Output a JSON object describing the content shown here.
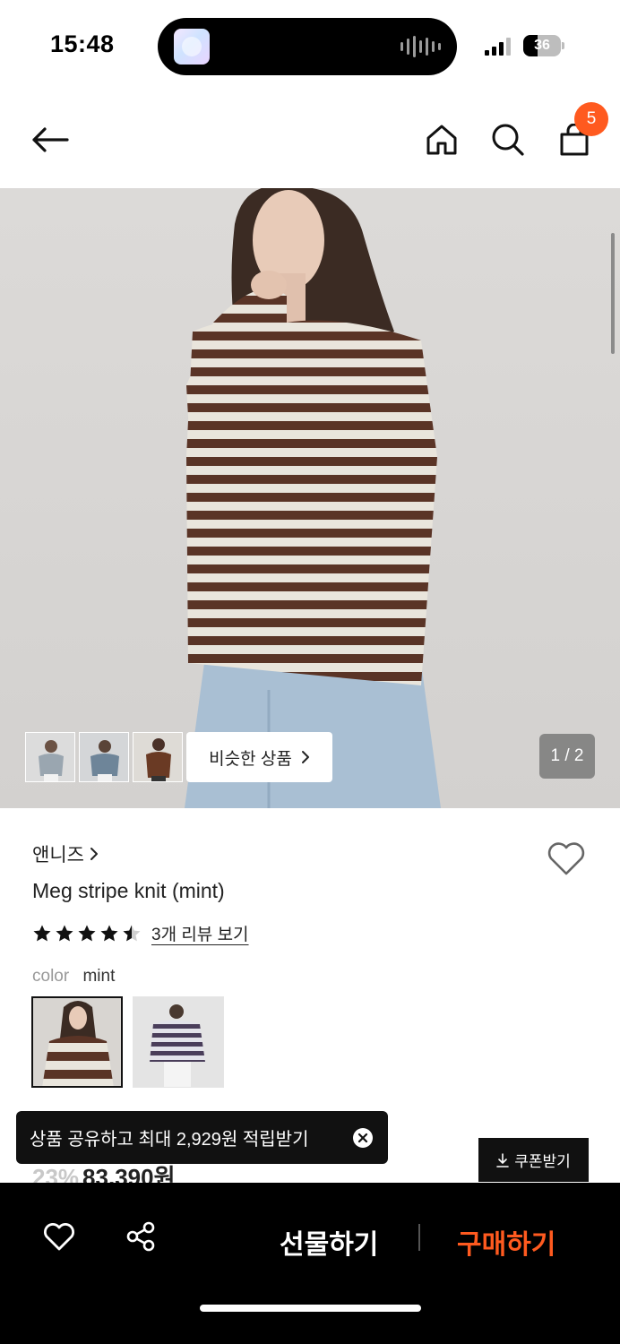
{
  "status_bar": {
    "time": "15:48",
    "battery": "36"
  },
  "nav": {
    "cart_count": "5"
  },
  "gallery": {
    "similar_label": "비슷한 상품",
    "page_counter": "1 / 2"
  },
  "product": {
    "brand": "앤니즈",
    "name": "Meg stripe knit (mint)",
    "rating": 4.5,
    "review_link": "3개 리뷰 보기",
    "color_label": "color",
    "color_value": "mint",
    "discount": "23%",
    "price": "83,390원"
  },
  "toast": {
    "message": "상품 공유하고 최대 2,929원 적립받기"
  },
  "coupon": {
    "label": "쿠폰받기"
  },
  "bottom_bar": {
    "gift_label": "선물하기",
    "buy_label": "구매하기"
  },
  "colors": {
    "accent": "#ff5a1f",
    "dark": "#111111"
  }
}
